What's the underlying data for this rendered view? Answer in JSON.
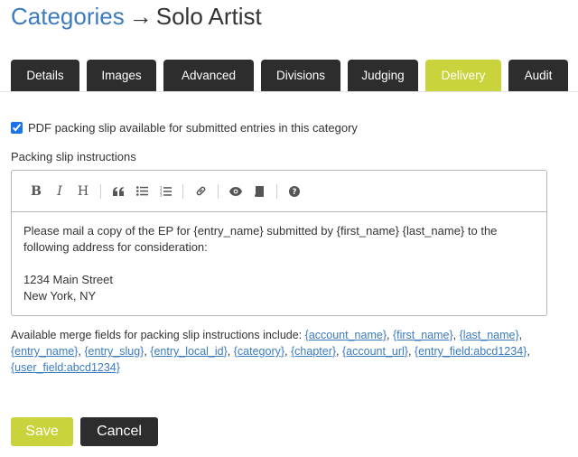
{
  "header": {
    "breadcrumb_link": "Categories",
    "arrow": "→",
    "title": "Solo Artist"
  },
  "tabs": [
    {
      "label": "Details",
      "active": false
    },
    {
      "label": "Images",
      "active": false
    },
    {
      "label": "Advanced",
      "active": false
    },
    {
      "label": "Divisions",
      "active": false
    },
    {
      "label": "Judging",
      "active": false
    },
    {
      "label": "Delivery",
      "active": true
    },
    {
      "label": "Audit",
      "active": false
    }
  ],
  "form": {
    "checkbox_label": "PDF packing slip available for submitted entries in this category",
    "checkbox_checked": true,
    "instructions_label": "Packing slip instructions"
  },
  "toolbar": {
    "icons": [
      "bold-icon",
      "italic-icon",
      "heading-icon",
      "quote-icon",
      "bullet-list-icon",
      "numbered-list-icon",
      "link-icon",
      "preview-icon",
      "side-by-side-icon",
      "help-icon"
    ]
  },
  "editor": {
    "line1": "Please mail a copy of the EP for {entry_name} submitted by {first_name} {last_name} to the",
    "line2": "following address for consideration:",
    "line3": "1234 Main Street",
    "line4": "New York, NY"
  },
  "merge": {
    "intro": "Available merge fields for packing slip instructions include:",
    "fields": [
      "{account_name}",
      "{first_name}",
      "{last_name}",
      "{entry_name}",
      "{entry_slug}",
      "{entry_local_id}",
      "{category}",
      "{chapter}",
      "{account_url}",
      "{entry_field:abcd1234}",
      "{user_field:abcd1234}"
    ]
  },
  "actions": {
    "save_label": "Save",
    "cancel_label": "Cancel"
  },
  "colors": {
    "accent": "#c9d43c",
    "dark": "#2d2d2d",
    "link": "#3b7bbf"
  }
}
